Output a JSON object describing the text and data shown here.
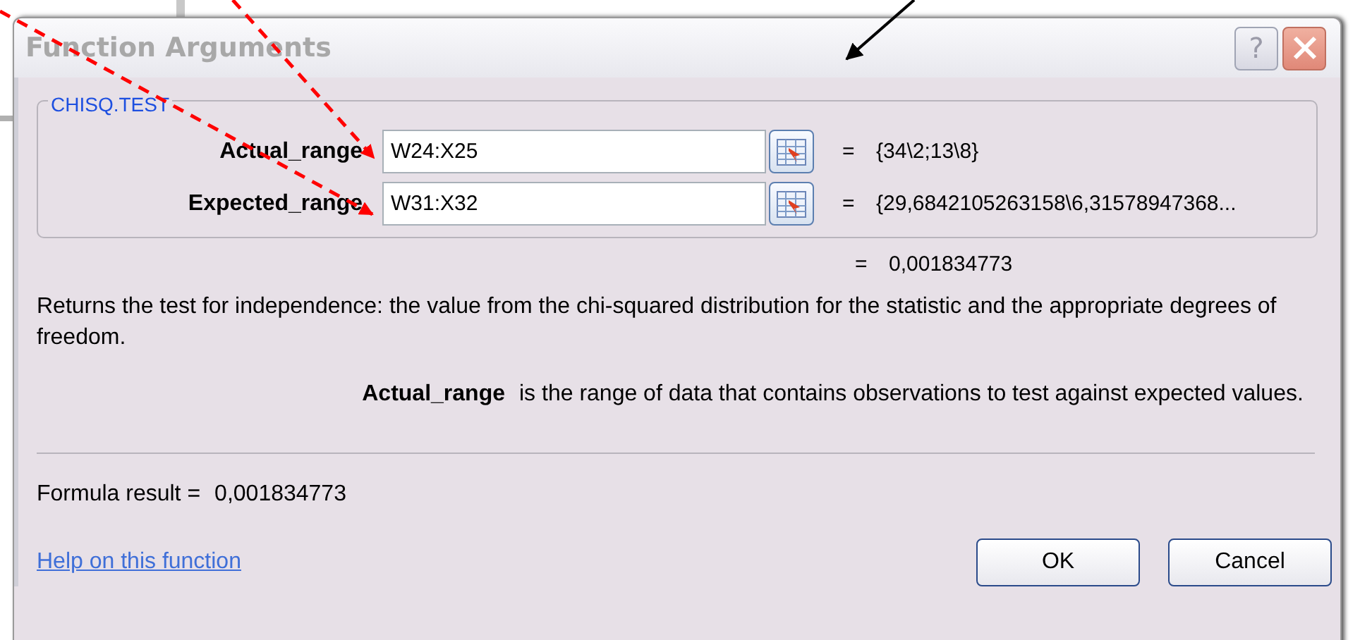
{
  "window": {
    "title": "Function Arguments",
    "help_glyph": "?"
  },
  "function_name": "CHISQ.TEST",
  "arguments": [
    {
      "label": "Actual_range",
      "value": "W24:X25",
      "result": "{34\\2;13\\8}"
    },
    {
      "label": "Expected_range",
      "value": "W31:X32",
      "result": "{29,6842105263158\\6,31578947368..."
    }
  ],
  "function_equals": "=",
  "function_result": "0,001834773",
  "argument_equals": "=",
  "description": "Returns the test for independence: the value from the chi-squared distribution for the statistic and the appropriate degrees of freedom.",
  "argument_help": {
    "label": "Actual_range",
    "text": "is the range of data that contains observations to test against expected values."
  },
  "formula_result": {
    "label": "Formula result =",
    "value": "0,001834773"
  },
  "help_link": "Help on this function",
  "buttons": [
    "OK",
    "Cancel"
  ]
}
